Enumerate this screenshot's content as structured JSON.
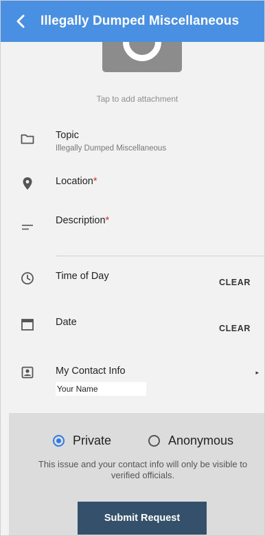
{
  "header": {
    "title": "Illegally Dumped Miscellaneous",
    "background": "#4a90e2"
  },
  "attachment": {
    "hint": "Tap to add attachment"
  },
  "fields": {
    "topic": {
      "label": "Topic",
      "value": "Illegally Dumped Miscellaneous",
      "icon": "folder-icon"
    },
    "location": {
      "label": "Location",
      "required_mark": "*",
      "icon": "location-pin-icon"
    },
    "description": {
      "label": "Description",
      "required_mark": "*",
      "icon": "short-text-icon"
    },
    "time_of_day": {
      "label": "Time of Day",
      "clear_label": "CLEAR",
      "icon": "clock-icon"
    },
    "date": {
      "label": "Date",
      "clear_label": "CLEAR",
      "icon": "calendar-icon"
    },
    "contact": {
      "label": "My Contact Info",
      "name_value": "Your Name",
      "icon": "contact-card-icon",
      "chevron": "▸"
    }
  },
  "privacy": {
    "options": [
      {
        "label": "Private",
        "selected": true
      },
      {
        "label": "Anonymous",
        "selected": false
      }
    ],
    "note": "This issue and your contact info will only be visible to verified officials.",
    "accent": "#2f7be6"
  },
  "submit": {
    "label": "Submit Request",
    "background": "#34506b"
  }
}
